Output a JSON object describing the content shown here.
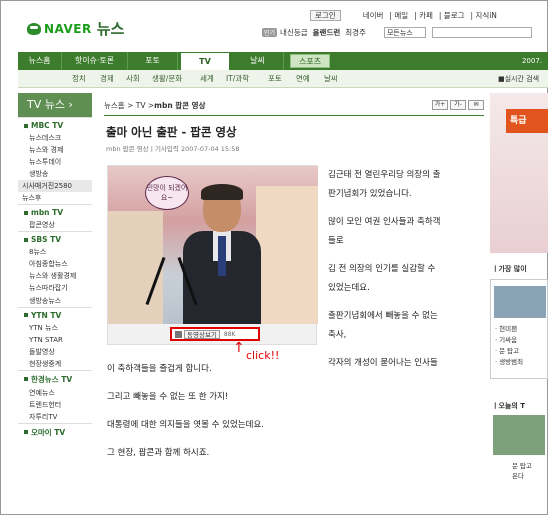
{
  "top_nav": {
    "login": "로그인",
    "items": [
      "네이버",
      "메일",
      "카페",
      "블로그",
      "지식iN"
    ]
  },
  "logo": {
    "brand": "NAVER",
    "section": "뉴스"
  },
  "keywords": {
    "badge": "인기",
    "items": [
      "내신등급",
      "올랜드런",
      "최경주"
    ],
    "search_select": "모든뉴스"
  },
  "main_nav": {
    "tabs": [
      "뉴스홈",
      "핫이슈·토론",
      "포토",
      "TV",
      "날씨"
    ],
    "sport": "스포츠",
    "date": "2007."
  },
  "sub_nav": {
    "items": [
      "정치",
      "경제",
      "사회",
      "생활/문화",
      "세계",
      "IT/과학",
      "포토",
      "연예",
      "날씨"
    ],
    "right": "■실시간 검색"
  },
  "sidebar": {
    "title": "TV 뉴스",
    "sections": [
      {
        "name": "MBC TV",
        "items": [
          "뉴스데스크",
          "뉴스와 경제",
          "뉴스투데이",
          "생방송"
        ]
      },
      {
        "name": "",
        "items": [
          "시사매거진2580",
          "뉴스후"
        ],
        "highlight": 0
      },
      {
        "name": "mbn TV",
        "items": [
          "팝콘영상"
        ]
      },
      {
        "name": "SBS TV",
        "items": [
          "8뉴스",
          "아침종합뉴스",
          "뉴스와 생활경제",
          "뉴스따라잡기",
          "생방송뉴스"
        ]
      },
      {
        "name": "YTN TV",
        "items": [
          "YTN 뉴스",
          "YTN STAR",
          "돌발영상",
          "현장생중계"
        ]
      },
      {
        "name": "한경뉴스 TV",
        "items": [
          "연예뉴스",
          "트렌드헌터",
          "자투리TV"
        ]
      },
      {
        "name": "오마이 TV",
        "items": []
      }
    ]
  },
  "breadcrumb": {
    "path": "뉴스홈 > TV > ",
    "current": "mbn 팝콘 영상",
    "icons": [
      "가+",
      "가-",
      "✉"
    ]
  },
  "article": {
    "title": "출마 아닌 출판 - 팝콘 영상",
    "meta": "mbn 팝콘 영상 | 기사입력 2007-07-04 15:58",
    "video": {
      "bubble_text": "민망이 되겠어요~",
      "play_label": "동영상보기",
      "size": "88K"
    },
    "annotation": "click!!",
    "paragraphs_right": [
      "김근태 전 열린우리당 의장의 출",
      "판기념회가 있었습니다.",
      "",
      "많이 모인 여권 인사들과 축하객",
      "들로",
      "",
      "김 전 의장의 인기를 실감할 수",
      "있었는데요.",
      "",
      "출판기념회에서 빼놓을 수 없는",
      "축사,",
      "",
      "각자의 개성이 묻어나는 인사들"
    ],
    "paragraphs_full": [
      "이 축하객들을 즐겁게 합니다.",
      "",
      "그리고 빼놓을 수 없는 또 한 가지!",
      "",
      "대통령에 대한 의지들을 엿볼 수 있었는데요.",
      "",
      "그 현장, 팝콘과 함께 하시죠."
    ]
  },
  "right_column": {
    "ad_text": "특급",
    "popular_head": "ㅣ가장 많이",
    "popular_items": [
      "· 현미팬",
      "· 기싸움",
      "· 문 탑고",
      "· 생방범죄"
    ],
    "today_head": "ㅣ오늘의 T",
    "today_caption": [
      "문 탑고",
      "온다"
    ]
  }
}
